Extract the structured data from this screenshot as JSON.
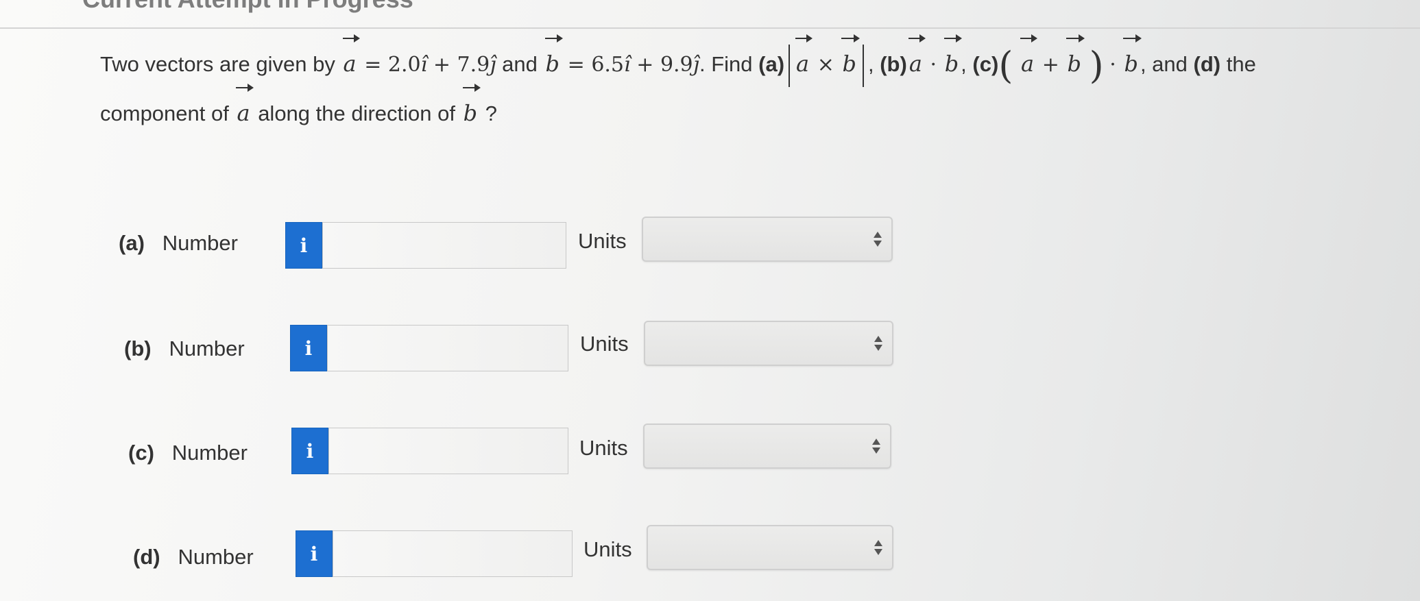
{
  "header": {
    "status_text": "Current Attempt in Progress"
  },
  "question": {
    "intro": "Two vectors are given by",
    "vec_a": "a",
    "vec_b": "b",
    "eq1": "= 2.0",
    "i_hat": "î",
    "plus1": "+ 7.9",
    "j_hat": "ĵ",
    "and1": "and",
    "eq2": "= 6.5",
    "plus2": "+ 9.9",
    "find": ". Find",
    "part_a_label": "(a)",
    "cross": "×",
    "comma_b": ",",
    "part_b_label": "(b)",
    "dot": "·",
    "comma_c": ",",
    "part_c_label": "(c)",
    "paren_open": "(",
    "plus_ab": "+",
    "paren_close": ")",
    "and2": ", and",
    "part_d_label": "(d)",
    "the": "the",
    "line2_start": "component of",
    "line2_mid": "along the direction of",
    "line2_end": "?"
  },
  "answers": [
    {
      "letter": "(a)",
      "label": "Number",
      "info_icon": "i",
      "value": "",
      "units_label": "Units",
      "units_value": ""
    },
    {
      "letter": "(b)",
      "label": "Number",
      "info_icon": "i",
      "value": "",
      "units_label": "Units",
      "units_value": ""
    },
    {
      "letter": "(c)",
      "label": "Number",
      "info_icon": "i",
      "value": "",
      "units_label": "Units",
      "units_value": ""
    },
    {
      "letter": "(d)",
      "label": "Number",
      "info_icon": "i",
      "value": "",
      "units_label": "Units",
      "units_value": ""
    }
  ],
  "icons": {
    "info": "info-icon",
    "select_arrows": "up-down-arrows-icon"
  },
  "colors": {
    "info_button": "#1d6fd1",
    "text": "#333333",
    "input_border": "#c8c8c8"
  }
}
